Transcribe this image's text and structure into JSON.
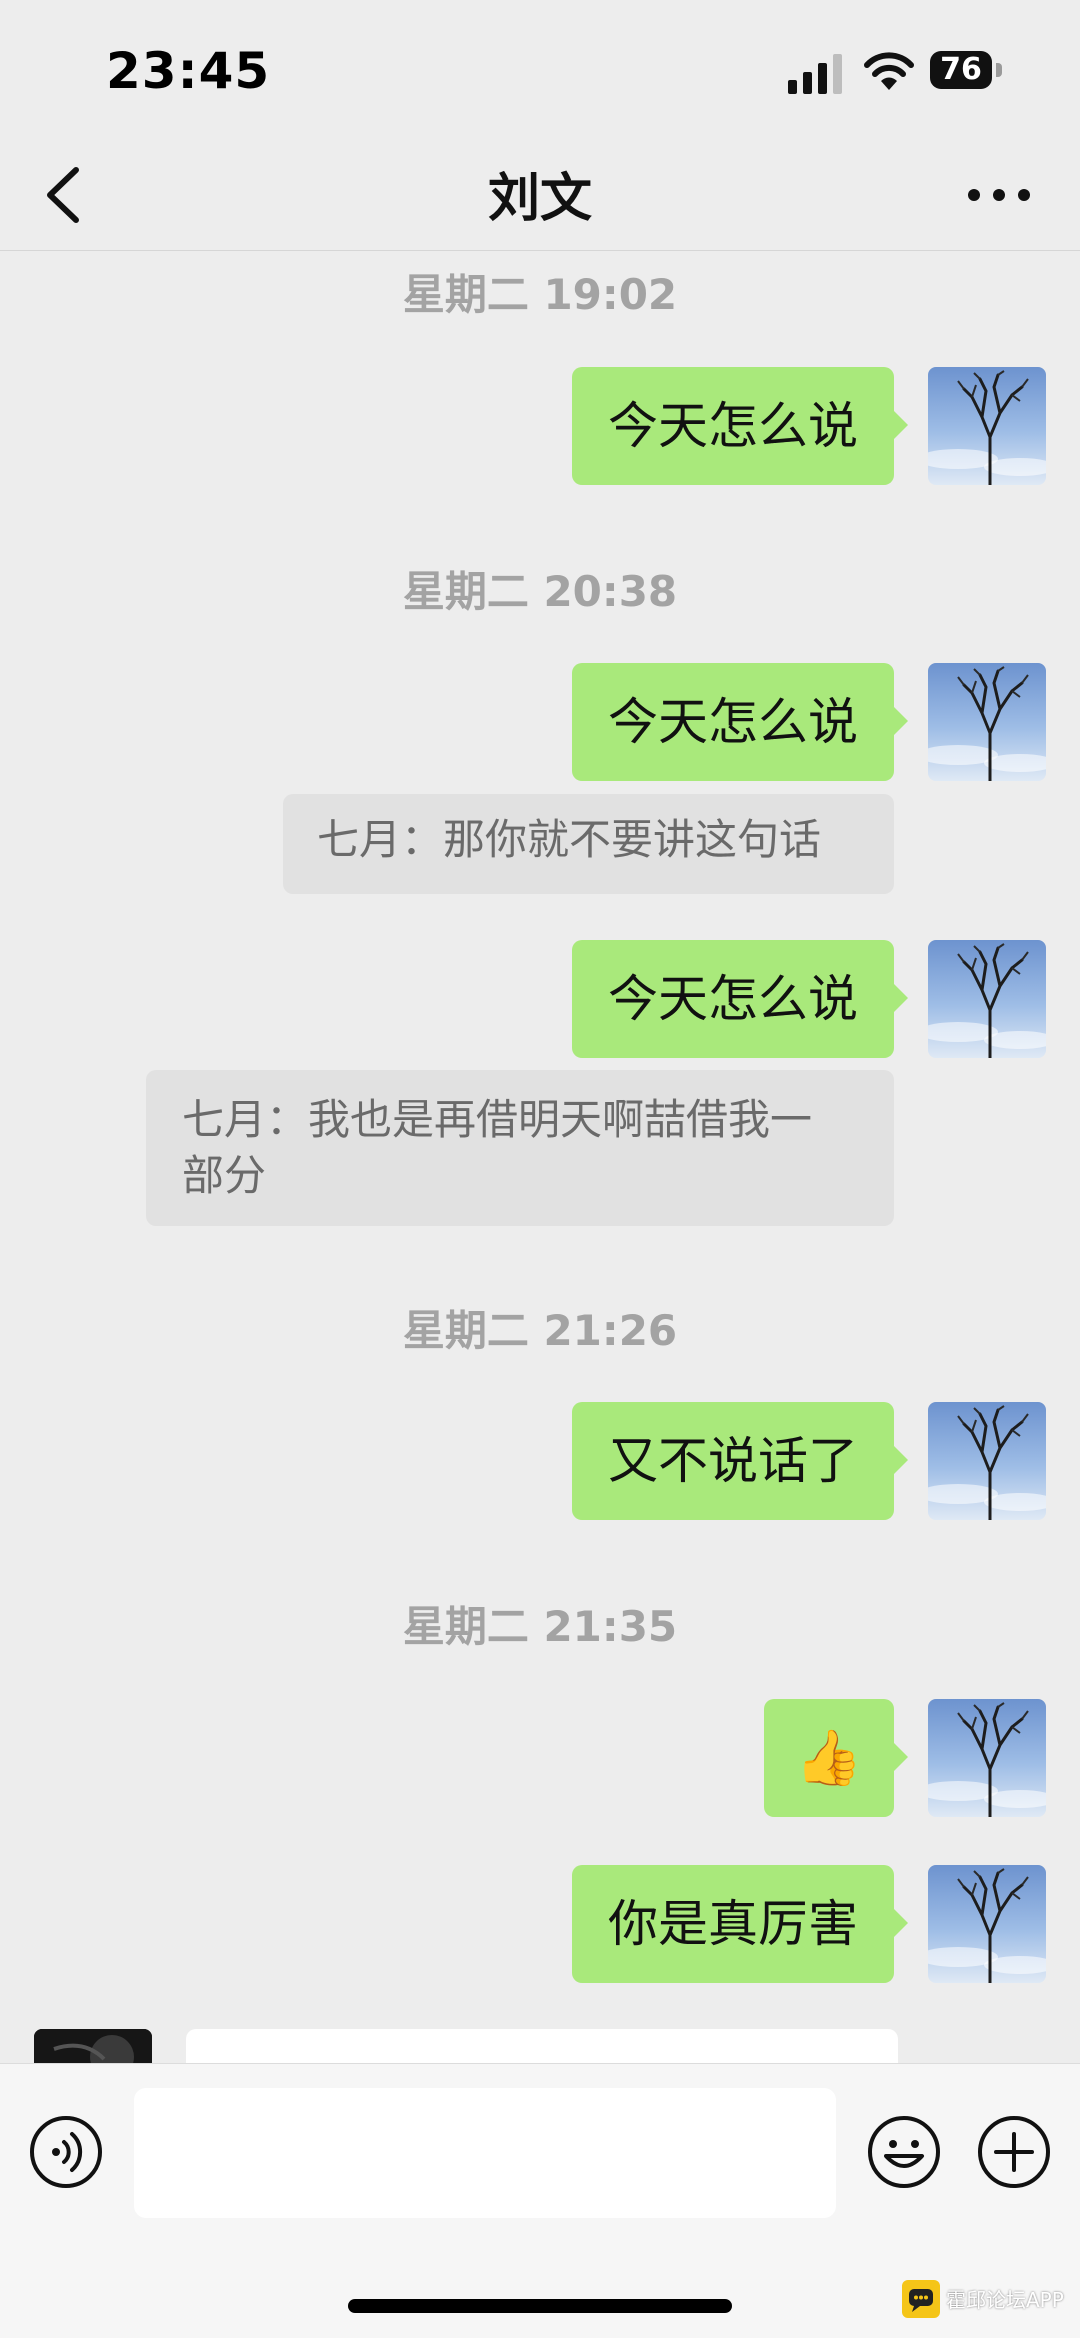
{
  "status_bar": {
    "time": "23:45",
    "battery": "76"
  },
  "nav": {
    "title": "刘文"
  },
  "messages": [
    {
      "timestamp": "星期二 19:02",
      "outgoing": "今天怎么说"
    },
    {
      "timestamp": "星期二 20:38",
      "outgoing": "今天怎么说",
      "quote": "七月：那你就不要讲这句话"
    },
    {
      "outgoing": "今天怎么说",
      "quote_line1": "七月：我也是再借明天啊喆借我一",
      "quote_line2": "部分"
    },
    {
      "timestamp": "星期二 21:26",
      "outgoing": "又不说话了"
    },
    {
      "timestamp": "星期二 21:35",
      "emoji": "👍"
    },
    {
      "outgoing": "你是真厉害"
    }
  ],
  "input": {
    "placeholder": ""
  },
  "watermark": {
    "text": "霍邱论坛APP"
  },
  "colors": {
    "bubble_out": "#a9e97b",
    "background": "#ededed",
    "quote_bg": "#e1e1e1"
  }
}
